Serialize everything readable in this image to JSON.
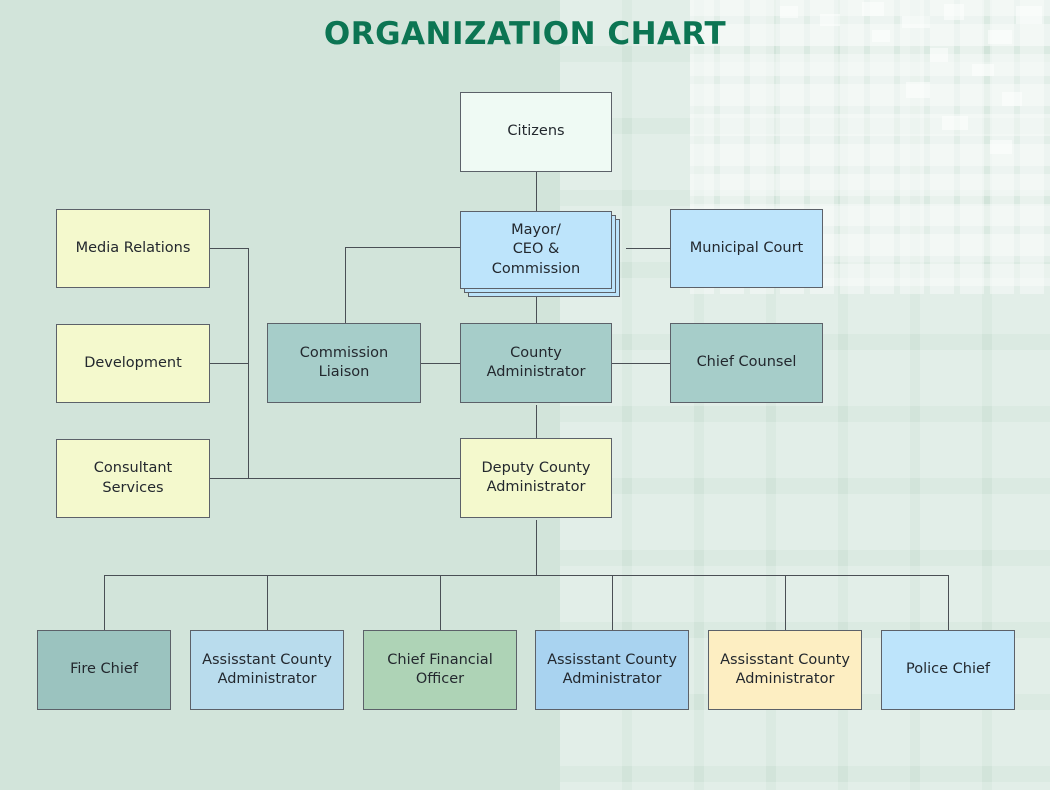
{
  "page": {
    "title": "ORGANIZATION CHART",
    "title_color": "#0c7553",
    "background_color": "#d2e4da",
    "connector_color": "#4a4f55",
    "border_color": "#5c6169"
  },
  "palette": {
    "white_mint": "#effaf4",
    "light_blue": "#bde4fb",
    "pale_yellow": "#f4f9cd",
    "teal": "#a6cdc9",
    "teal_dark": "#9bc3bf",
    "soft_blue": "#b9dced",
    "green": "#aed3b6",
    "sky_blue": "#a9d3f0",
    "cream": "#fdeec2"
  },
  "nodes": {
    "citizens": {
      "label": "Citizens",
      "fill": "#effaf4"
    },
    "mayor": {
      "label": "Mayor/\nCEO & Commission",
      "fill": "#bde4fb",
      "stacked": true
    },
    "municipal_court": {
      "label": "Municipal Court",
      "fill": "#bde4fb"
    },
    "media_relations": {
      "label": "Media Relations",
      "fill": "#f4f9cd"
    },
    "development": {
      "label": "Development",
      "fill": "#f4f9cd"
    },
    "consultant_services": {
      "label": "Consultant\nServices",
      "fill": "#f4f9cd"
    },
    "commission_liaison": {
      "label": "Commission\nLiaison",
      "fill": "#a6cdc9"
    },
    "county_administrator": {
      "label": "County\nAdministrator",
      "fill": "#a6cdc9"
    },
    "chief_counsel": {
      "label": "Chief Counsel",
      "fill": "#a6cdc9"
    },
    "deputy_county_administrator": {
      "label": "Deputy County\nAdministrator",
      "fill": "#f4f9cd"
    }
  },
  "bottom_row": [
    {
      "label": "Fire Chief",
      "fill": "#9bc3bf"
    },
    {
      "label": "Assisstant County\nAdministrator",
      "fill": "#b9dced"
    },
    {
      "label": "Chief Financial\nOfficer",
      "fill": "#aed3b6"
    },
    {
      "label": "Assisstant County\nAdministrator",
      "fill": "#a9d3f0"
    },
    {
      "label": "Assisstant County\nAdministrator",
      "fill": "#fdeec2"
    },
    {
      "label": "Police Chief",
      "fill": "#bde4fb"
    }
  ]
}
